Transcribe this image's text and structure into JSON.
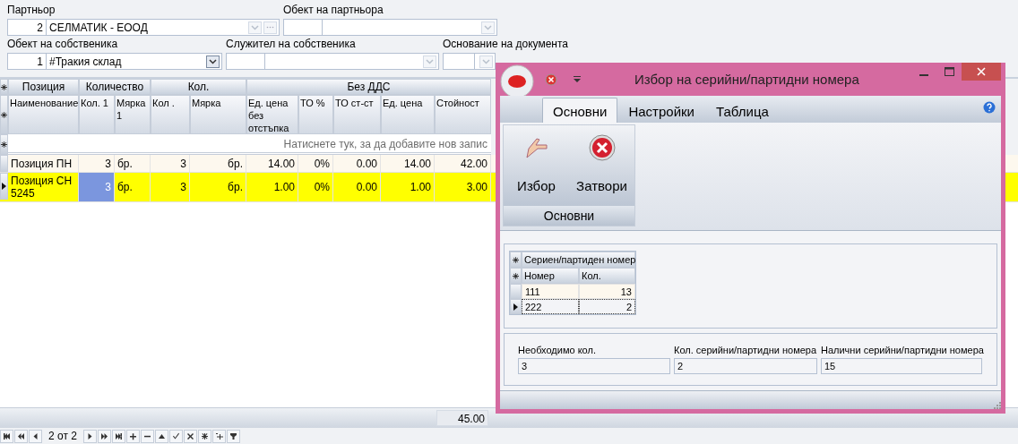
{
  "header_fields": {
    "partner": {
      "label": "Партньор",
      "code": "2",
      "name": "СЕЛМАТИК - ЕООД"
    },
    "partner_object": {
      "label": "Обект на партньора"
    },
    "owner_object": {
      "label": "Обект на собственика",
      "code": "1",
      "name": "#Тракия склад"
    },
    "owner_employee": {
      "label": "Служител на собственика"
    },
    "document_basis": {
      "label": "Основание на документа"
    }
  },
  "grid": {
    "groups": [
      {
        "label": "Позиция",
        "columns": [
          "Наименование"
        ]
      },
      {
        "label": "Количество",
        "columns": [
          "Кол. 1",
          "Мярка 1"
        ]
      },
      {
        "label": "Кол.",
        "columns": [
          "Кол .",
          "Мярка"
        ]
      },
      {
        "label": "Без ДДС",
        "columns": [
          "Ед. цена без отстъпка",
          "ТО %",
          "ТО ст-ст",
          "Ед. цена",
          "Стойност"
        ]
      }
    ],
    "new_row_prompt": "Натиснете тук, за да добавите нов запис",
    "rows": [
      {
        "selected": false,
        "color": "#fdf8ee",
        "cells": [
          {
            "text": "Позиция ПН",
            "focused": false
          },
          {
            "text": "3",
            "focused": false
          },
          {
            "text": "бр.",
            "focused": false
          },
          {
            "text": "3",
            "focused": false
          },
          {
            "text": "бр.",
            "focused": false
          },
          {
            "text": "14.00",
            "focused": false
          },
          {
            "text": "0%",
            "focused": false
          },
          {
            "text": "0.00",
            "focused": false
          },
          {
            "text": "14.00",
            "focused": false
          },
          {
            "text": "42.00",
            "focused": false
          }
        ]
      },
      {
        "selected": true,
        "color": "#ffff00",
        "cells": [
          {
            "text": "Позиция СН 5245",
            "focused": false
          },
          {
            "text": "3",
            "focused": true
          },
          {
            "text": "бр.",
            "focused": false
          },
          {
            "text": "3",
            "focused": false
          },
          {
            "text": "бр.",
            "focused": false
          },
          {
            "text": "1.00",
            "focused": false
          },
          {
            "text": "0%",
            "focused": false
          },
          {
            "text": "0.00",
            "focused": false
          },
          {
            "text": "1.00",
            "focused": false
          },
          {
            "text": "3.00",
            "focused": false
          }
        ]
      }
    ],
    "total": "45.00"
  },
  "navigator": {
    "record": "2 от 2"
  },
  "dialog": {
    "title": "Избор на серийни/партидни номера",
    "tabs": [
      {
        "label": "Основни",
        "selected": true
      },
      {
        "label": "Настройки",
        "selected": false
      },
      {
        "label": "Таблица",
        "selected": false
      }
    ],
    "ribbon_buttons": [
      {
        "label": "Избор",
        "kind": "pick"
      },
      {
        "label": "Затвори",
        "kind": "close"
      }
    ],
    "ribbon_group": "Основни",
    "serial_grid": {
      "band": "Сериен/партиден номер",
      "columns": [
        "Номер",
        "Кол."
      ],
      "rows": [
        {
          "selected": false,
          "cells": [
            "111",
            "13"
          ]
        },
        {
          "selected": true,
          "cells": [
            "222",
            "2"
          ]
        }
      ]
    },
    "summary": [
      {
        "label": "Необходимо кол.",
        "value": "3"
      },
      {
        "label": "Кол. серийни/партидни номера",
        "value": "2"
      },
      {
        "label": "Налични серийни/партидни номера",
        "value": "15"
      }
    ]
  }
}
